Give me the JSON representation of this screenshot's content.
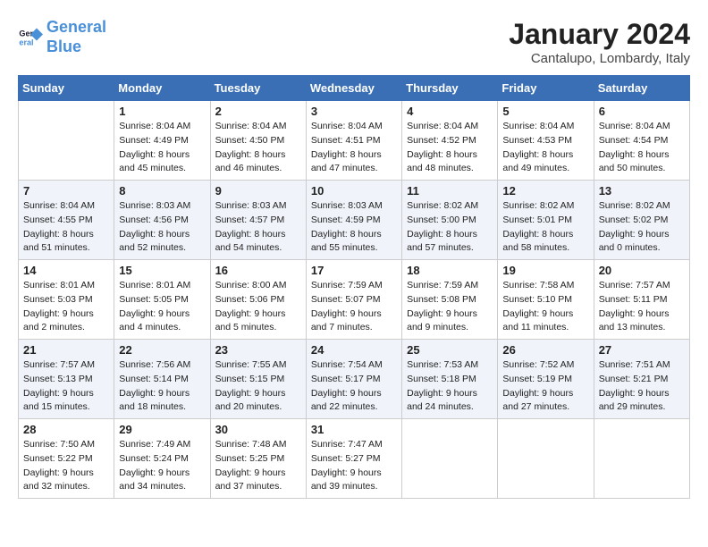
{
  "logo": {
    "line1": "General",
    "line2": "Blue"
  },
  "title": "January 2024",
  "subtitle": "Cantalupo, Lombardy, Italy",
  "weekdays": [
    "Sunday",
    "Monday",
    "Tuesday",
    "Wednesday",
    "Thursday",
    "Friday",
    "Saturday"
  ],
  "weeks": [
    [
      {
        "num": "",
        "info": ""
      },
      {
        "num": "1",
        "info": "Sunrise: 8:04 AM\nSunset: 4:49 PM\nDaylight: 8 hours\nand 45 minutes."
      },
      {
        "num": "2",
        "info": "Sunrise: 8:04 AM\nSunset: 4:50 PM\nDaylight: 8 hours\nand 46 minutes."
      },
      {
        "num": "3",
        "info": "Sunrise: 8:04 AM\nSunset: 4:51 PM\nDaylight: 8 hours\nand 47 minutes."
      },
      {
        "num": "4",
        "info": "Sunrise: 8:04 AM\nSunset: 4:52 PM\nDaylight: 8 hours\nand 48 minutes."
      },
      {
        "num": "5",
        "info": "Sunrise: 8:04 AM\nSunset: 4:53 PM\nDaylight: 8 hours\nand 49 minutes."
      },
      {
        "num": "6",
        "info": "Sunrise: 8:04 AM\nSunset: 4:54 PM\nDaylight: 8 hours\nand 50 minutes."
      }
    ],
    [
      {
        "num": "7",
        "info": "Sunrise: 8:04 AM\nSunset: 4:55 PM\nDaylight: 8 hours\nand 51 minutes."
      },
      {
        "num": "8",
        "info": "Sunrise: 8:03 AM\nSunset: 4:56 PM\nDaylight: 8 hours\nand 52 minutes."
      },
      {
        "num": "9",
        "info": "Sunrise: 8:03 AM\nSunset: 4:57 PM\nDaylight: 8 hours\nand 54 minutes."
      },
      {
        "num": "10",
        "info": "Sunrise: 8:03 AM\nSunset: 4:59 PM\nDaylight: 8 hours\nand 55 minutes."
      },
      {
        "num": "11",
        "info": "Sunrise: 8:02 AM\nSunset: 5:00 PM\nDaylight: 8 hours\nand 57 minutes."
      },
      {
        "num": "12",
        "info": "Sunrise: 8:02 AM\nSunset: 5:01 PM\nDaylight: 8 hours\nand 58 minutes."
      },
      {
        "num": "13",
        "info": "Sunrise: 8:02 AM\nSunset: 5:02 PM\nDaylight: 9 hours\nand 0 minutes."
      }
    ],
    [
      {
        "num": "14",
        "info": "Sunrise: 8:01 AM\nSunset: 5:03 PM\nDaylight: 9 hours\nand 2 minutes."
      },
      {
        "num": "15",
        "info": "Sunrise: 8:01 AM\nSunset: 5:05 PM\nDaylight: 9 hours\nand 4 minutes."
      },
      {
        "num": "16",
        "info": "Sunrise: 8:00 AM\nSunset: 5:06 PM\nDaylight: 9 hours\nand 5 minutes."
      },
      {
        "num": "17",
        "info": "Sunrise: 7:59 AM\nSunset: 5:07 PM\nDaylight: 9 hours\nand 7 minutes."
      },
      {
        "num": "18",
        "info": "Sunrise: 7:59 AM\nSunset: 5:08 PM\nDaylight: 9 hours\nand 9 minutes."
      },
      {
        "num": "19",
        "info": "Sunrise: 7:58 AM\nSunset: 5:10 PM\nDaylight: 9 hours\nand 11 minutes."
      },
      {
        "num": "20",
        "info": "Sunrise: 7:57 AM\nSunset: 5:11 PM\nDaylight: 9 hours\nand 13 minutes."
      }
    ],
    [
      {
        "num": "21",
        "info": "Sunrise: 7:57 AM\nSunset: 5:13 PM\nDaylight: 9 hours\nand 15 minutes."
      },
      {
        "num": "22",
        "info": "Sunrise: 7:56 AM\nSunset: 5:14 PM\nDaylight: 9 hours\nand 18 minutes."
      },
      {
        "num": "23",
        "info": "Sunrise: 7:55 AM\nSunset: 5:15 PM\nDaylight: 9 hours\nand 20 minutes."
      },
      {
        "num": "24",
        "info": "Sunrise: 7:54 AM\nSunset: 5:17 PM\nDaylight: 9 hours\nand 22 minutes."
      },
      {
        "num": "25",
        "info": "Sunrise: 7:53 AM\nSunset: 5:18 PM\nDaylight: 9 hours\nand 24 minutes."
      },
      {
        "num": "26",
        "info": "Sunrise: 7:52 AM\nSunset: 5:19 PM\nDaylight: 9 hours\nand 27 minutes."
      },
      {
        "num": "27",
        "info": "Sunrise: 7:51 AM\nSunset: 5:21 PM\nDaylight: 9 hours\nand 29 minutes."
      }
    ],
    [
      {
        "num": "28",
        "info": "Sunrise: 7:50 AM\nSunset: 5:22 PM\nDaylight: 9 hours\nand 32 minutes."
      },
      {
        "num": "29",
        "info": "Sunrise: 7:49 AM\nSunset: 5:24 PM\nDaylight: 9 hours\nand 34 minutes."
      },
      {
        "num": "30",
        "info": "Sunrise: 7:48 AM\nSunset: 5:25 PM\nDaylight: 9 hours\nand 37 minutes."
      },
      {
        "num": "31",
        "info": "Sunrise: 7:47 AM\nSunset: 5:27 PM\nDaylight: 9 hours\nand 39 minutes."
      },
      {
        "num": "",
        "info": ""
      },
      {
        "num": "",
        "info": ""
      },
      {
        "num": "",
        "info": ""
      }
    ]
  ]
}
